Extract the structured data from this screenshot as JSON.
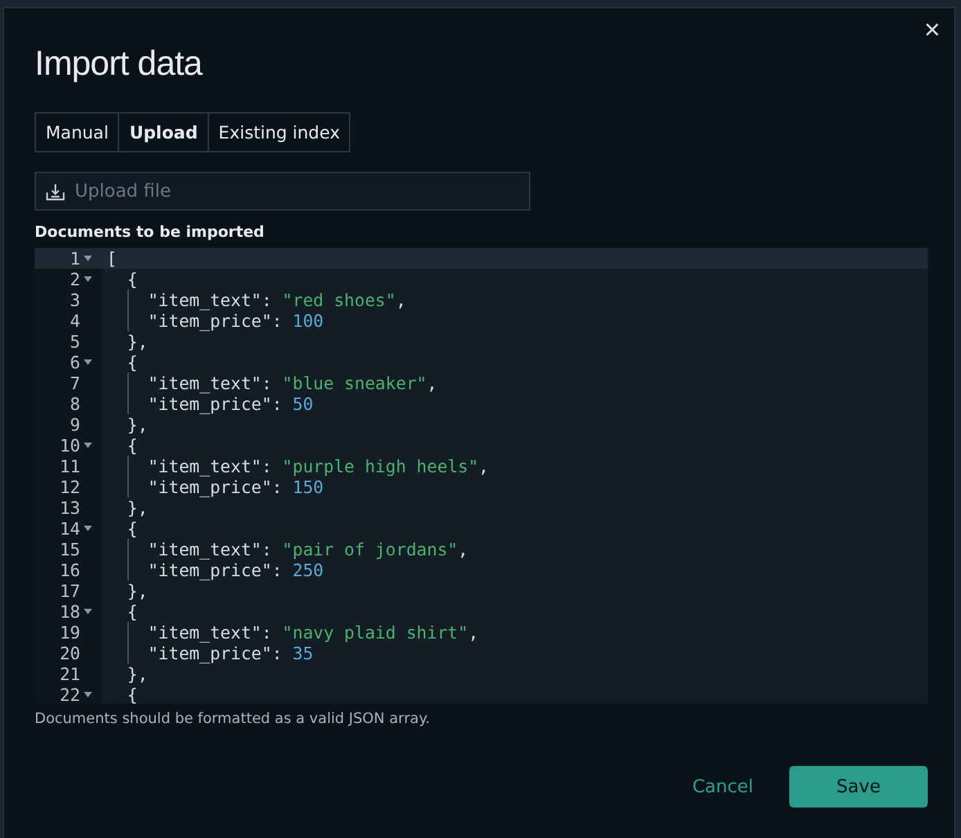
{
  "dialog": {
    "title": "Import data",
    "close": "×"
  },
  "tabs": [
    {
      "label": "Manual",
      "selected": false
    },
    {
      "label": "Upload",
      "selected": true
    },
    {
      "label": "Existing index",
      "selected": false
    }
  ],
  "upload_field": {
    "placeholder": "Upload file"
  },
  "editor": {
    "label": "Documents to be imported",
    "lines": [
      {
        "number": "1",
        "foldable": true,
        "active": true,
        "tokens": [
          {
            "kind": "punct",
            "text": "["
          }
        ],
        "children": [
          {
            "number": "2",
            "foldable": true,
            "active": false,
            "tokens": [
              {
                "kind": "punct",
                "text": "{"
              }
            ],
            "children": [
              {
                "number": "3",
                "foldable": false,
                "active": false,
                "tokens": [
                  {
                    "kind": "key",
                    "text": "\"item_text\""
                  },
                  {
                    "kind": "punct",
                    "text": ": "
                  },
                  {
                    "kind": "string",
                    "text": "\"red shoes\""
                  },
                  {
                    "kind": "punct",
                    "text": ","
                  }
                ]
              },
              {
                "number": "4",
                "foldable": false,
                "active": false,
                "tokens": [
                  {
                    "kind": "key",
                    "text": "\"item_price\""
                  },
                  {
                    "kind": "punct",
                    "text": ": "
                  },
                  {
                    "kind": "number",
                    "text": "100"
                  }
                ]
              }
            ]
          },
          {
            "number": "5",
            "foldable": false,
            "active": false,
            "tokens": [
              {
                "kind": "punct",
                "text": "},"
              }
            ]
          },
          {
            "number": "6",
            "foldable": true,
            "active": false,
            "tokens": [
              {
                "kind": "punct",
                "text": "{"
              }
            ],
            "children": [
              {
                "number": "7",
                "foldable": false,
                "active": false,
                "tokens": [
                  {
                    "kind": "key",
                    "text": "\"item_text\""
                  },
                  {
                    "kind": "punct",
                    "text": ": "
                  },
                  {
                    "kind": "string",
                    "text": "\"blue sneaker\""
                  },
                  {
                    "kind": "punct",
                    "text": ","
                  }
                ]
              },
              {
                "number": "8",
                "foldable": false,
                "active": false,
                "tokens": [
                  {
                    "kind": "key",
                    "text": "\"item_price\""
                  },
                  {
                    "kind": "punct",
                    "text": ": "
                  },
                  {
                    "kind": "number",
                    "text": "50"
                  }
                ]
              }
            ]
          },
          {
            "number": "9",
            "foldable": false,
            "active": false,
            "tokens": [
              {
                "kind": "punct",
                "text": "},"
              }
            ]
          },
          {
            "number": "10",
            "foldable": true,
            "active": false,
            "tokens": [
              {
                "kind": "punct",
                "text": "{"
              }
            ],
            "children": [
              {
                "number": "11",
                "foldable": false,
                "active": false,
                "tokens": [
                  {
                    "kind": "key",
                    "text": "\"item_text\""
                  },
                  {
                    "kind": "punct",
                    "text": ": "
                  },
                  {
                    "kind": "string",
                    "text": "\"purple high heels\""
                  },
                  {
                    "kind": "punct",
                    "text": ","
                  }
                ]
              },
              {
                "number": "12",
                "foldable": false,
                "active": false,
                "tokens": [
                  {
                    "kind": "key",
                    "text": "\"item_price\""
                  },
                  {
                    "kind": "punct",
                    "text": ": "
                  },
                  {
                    "kind": "number",
                    "text": "150"
                  }
                ]
              }
            ]
          },
          {
            "number": "13",
            "foldable": false,
            "active": false,
            "tokens": [
              {
                "kind": "punct",
                "text": "},"
              }
            ]
          },
          {
            "number": "14",
            "foldable": true,
            "active": false,
            "tokens": [
              {
                "kind": "punct",
                "text": "{"
              }
            ],
            "children": [
              {
                "number": "15",
                "foldable": false,
                "active": false,
                "tokens": [
                  {
                    "kind": "key",
                    "text": "\"item_text\""
                  },
                  {
                    "kind": "punct",
                    "text": ": "
                  },
                  {
                    "kind": "string",
                    "text": "\"pair of jordans\""
                  },
                  {
                    "kind": "punct",
                    "text": ","
                  }
                ]
              },
              {
                "number": "16",
                "foldable": false,
                "active": false,
                "tokens": [
                  {
                    "kind": "key",
                    "text": "\"item_price\""
                  },
                  {
                    "kind": "punct",
                    "text": ": "
                  },
                  {
                    "kind": "number",
                    "text": "250"
                  }
                ]
              }
            ]
          },
          {
            "number": "17",
            "foldable": false,
            "active": false,
            "tokens": [
              {
                "kind": "punct",
                "text": "},"
              }
            ]
          },
          {
            "number": "18",
            "foldable": true,
            "active": false,
            "tokens": [
              {
                "kind": "punct",
                "text": "{"
              }
            ],
            "children": [
              {
                "number": "19",
                "foldable": false,
                "active": false,
                "tokens": [
                  {
                    "kind": "key",
                    "text": "\"item_text\""
                  },
                  {
                    "kind": "punct",
                    "text": ": "
                  },
                  {
                    "kind": "string",
                    "text": "\"navy plaid shirt\""
                  },
                  {
                    "kind": "punct",
                    "text": ","
                  }
                ]
              },
              {
                "number": "20",
                "foldable": false,
                "active": false,
                "tokens": [
                  {
                    "kind": "key",
                    "text": "\"item_price\""
                  },
                  {
                    "kind": "punct",
                    "text": ": "
                  },
                  {
                    "kind": "number",
                    "text": "35"
                  }
                ]
              }
            ]
          },
          {
            "number": "21",
            "foldable": false,
            "active": false,
            "tokens": [
              {
                "kind": "punct",
                "text": "},"
              }
            ]
          },
          {
            "number": "22",
            "foldable": true,
            "active": false,
            "tokens": [
              {
                "kind": "punct",
                "text": "{"
              }
            ]
          }
        ]
      }
    ],
    "hint": "Documents should be formatted as a valid JSON array."
  },
  "buttons": [
    {
      "kind": "link",
      "label": "Cancel"
    },
    {
      "kind": "primary",
      "label": "Save"
    }
  ]
}
